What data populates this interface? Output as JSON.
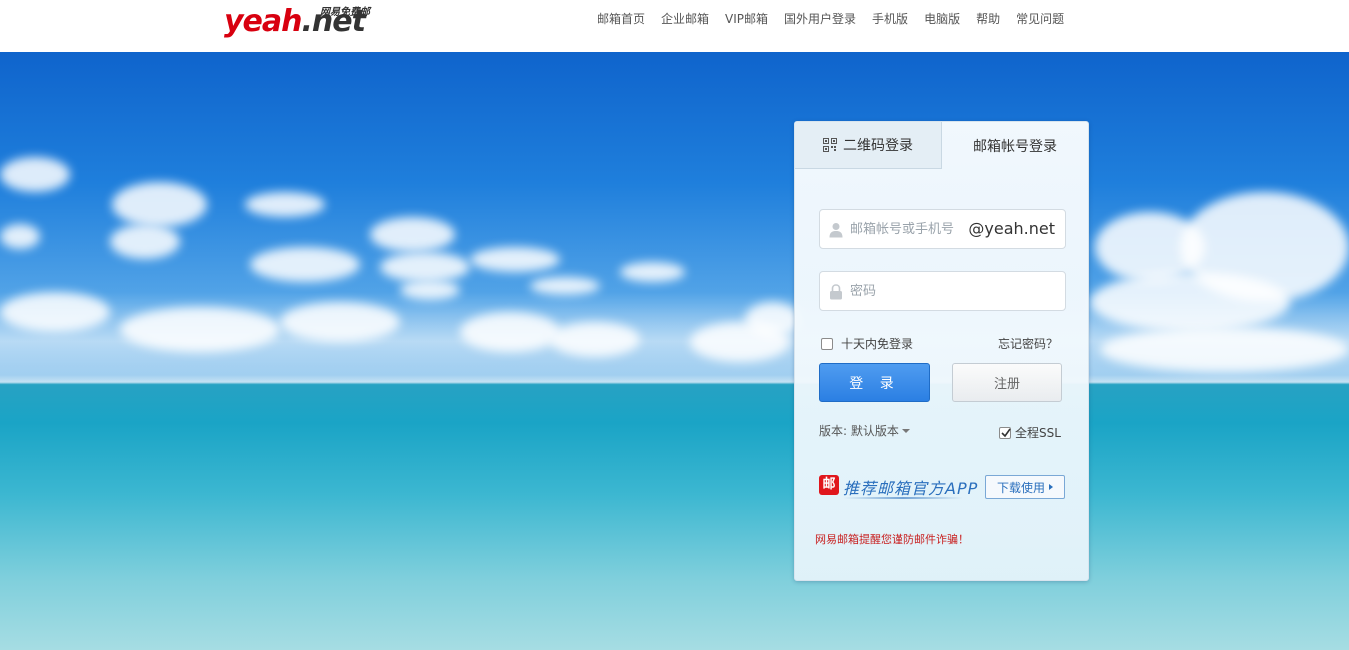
{
  "logo": {
    "part1": "yeah",
    "part2": ".net",
    "tagline": "网易免费邮"
  },
  "nav": [
    {
      "label": "邮箱首页"
    },
    {
      "label": "企业邮箱"
    },
    {
      "label": "VIP邮箱"
    },
    {
      "label": "国外用户登录"
    },
    {
      "label": "手机版"
    },
    {
      "label": "电脑版"
    },
    {
      "label": "帮助"
    },
    {
      "label": "常见问题"
    }
  ],
  "login": {
    "tab_qr": "二维码登录",
    "tab_account": "邮箱帐号登录",
    "active_tab": "account",
    "username_placeholder": "邮箱帐号或手机号",
    "username_value": "",
    "domain_suffix": "@yeah.net",
    "password_placeholder": "密码",
    "password_value": "",
    "remember_label": "十天内免登录",
    "remember_checked": false,
    "forgot_label": "忘记密码？",
    "login_button": "登 录",
    "register_button": "注册",
    "version_label": "版本: 默认版本",
    "ssl_label": "全程SSL",
    "ssl_checked": true,
    "app_icon_char": "邮",
    "app_promo": "推荐邮箱官方APP",
    "app_download": "下载使用",
    "warning": "网易邮箱提醒您谨防邮件诈骗！"
  },
  "colors": {
    "brand_red": "#d8000f",
    "primary_blue": "#2b7fe3",
    "link_blue": "#2a6fbd",
    "warning_red": "#c81f1f"
  }
}
